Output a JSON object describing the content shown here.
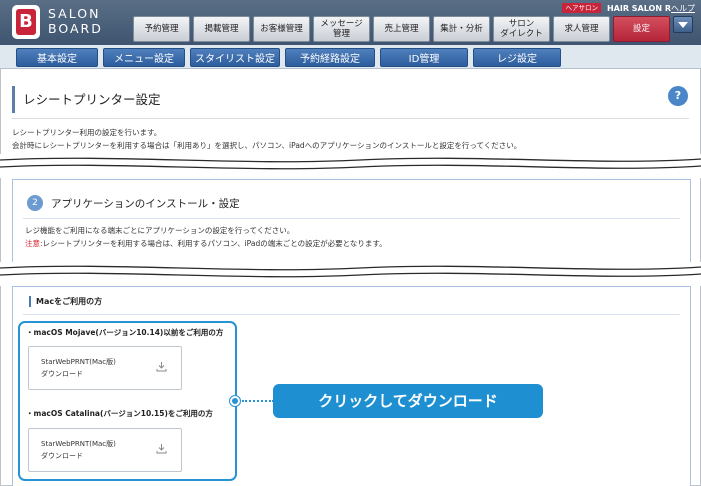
{
  "brand": {
    "line1": "SALON",
    "line2": "BOARD",
    "logo_letter": "B"
  },
  "header": {
    "badge": "ヘアサロン",
    "salon_name": "HAIR SALON R",
    "help_link": "ヘルプ",
    "nav": [
      {
        "label": "予約管理"
      },
      {
        "label": "掲載管理"
      },
      {
        "label": "お客様管理"
      },
      {
        "label": "メッセージ\n管理"
      },
      {
        "label": "売上管理"
      },
      {
        "label": "集計・分析"
      },
      {
        "label": "サロン\nダイレクト"
      },
      {
        "label": "求人管理"
      },
      {
        "label": "設定"
      }
    ]
  },
  "subnav": [
    {
      "label": "基本設定"
    },
    {
      "label": "メニュー設定"
    },
    {
      "label": "スタイリスト設定"
    },
    {
      "label": "予約経路設定"
    },
    {
      "label": "ID管理"
    },
    {
      "label": "レジ設定"
    }
  ],
  "page": {
    "title": "レシートプリンター設定",
    "help": "?",
    "intro_line1": "レシートプリンター利用の設定を行います。",
    "intro_line2": "会計時にレシートプリンターを利用する場合は「利用あり」を選択し、パソコン、iPadへのアプリケーションのインストールと設定を行ってください。"
  },
  "section2": {
    "step": "2",
    "title": "アプリケーションのインストール・設定",
    "desc": "レジ機能をご利用になる端末ごとにアプリケーションの設定を行ってください。",
    "warn_label": "注意:",
    "warn_text": "レシートプリンターを利用する場合は、利用するパソコン、iPadの端末ごとの設定が必要となります。"
  },
  "mac": {
    "title": "Macをご利用の方",
    "mojave_heading": "・macOS Mojave(バージョン10.14)以前をご利用の方",
    "catalina_heading": "・macOS Catalina(バージョン10.15)をご利用の方",
    "download_line1": "StarWebPRNT(Mac版)",
    "download_line2": "ダウンロード"
  },
  "callout": {
    "text": "クリックしてダウンロード"
  },
  "colors": {
    "accent": "#2693d5",
    "brand_red": "#c8243a",
    "nav_blue": "#2d5d9c"
  }
}
